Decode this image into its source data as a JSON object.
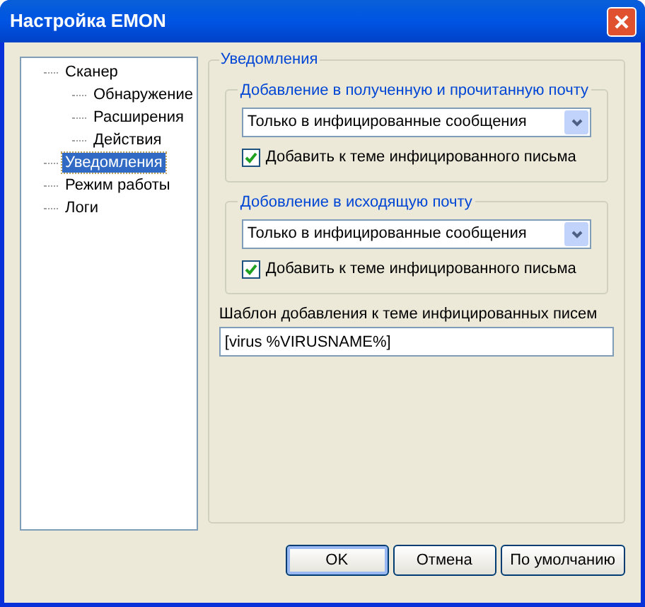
{
  "window": {
    "title": "Настройка EMON"
  },
  "tree": [
    {
      "label": "Сканер",
      "selected": false,
      "children": [
        {
          "label": "Обнаружение",
          "selected": false
        },
        {
          "label": "Расширения",
          "selected": false
        },
        {
          "label": "Действия",
          "selected": false
        }
      ]
    },
    {
      "label": "Уведомления",
      "selected": true
    },
    {
      "label": "Режим работы",
      "selected": false
    },
    {
      "label": "Логи",
      "selected": false
    }
  ],
  "section": {
    "title": "Уведомления",
    "groups": [
      {
        "title": "Добавление в полученную и прочитанную почту",
        "dropdown": {
          "value": "Только в инфицированные сообщения"
        },
        "checkbox": {
          "label": "Добавить к теме инфицированного письма",
          "checked": true
        }
      },
      {
        "title": "Добовление в исходящую почту",
        "dropdown": {
          "value": "Только в инфицированные сообщения"
        },
        "checkbox": {
          "label": "Добавить к теме инфицированного письма",
          "checked": true
        }
      }
    ],
    "template": {
      "label": "Шаблон добавления к теме инфицированных писем",
      "value": "[virus %VIRUSNAME%]"
    }
  },
  "buttons": [
    {
      "label": "OK",
      "default": true
    },
    {
      "label": "Отмена",
      "default": false
    },
    {
      "label": "По умолчанию",
      "default": false
    }
  ]
}
